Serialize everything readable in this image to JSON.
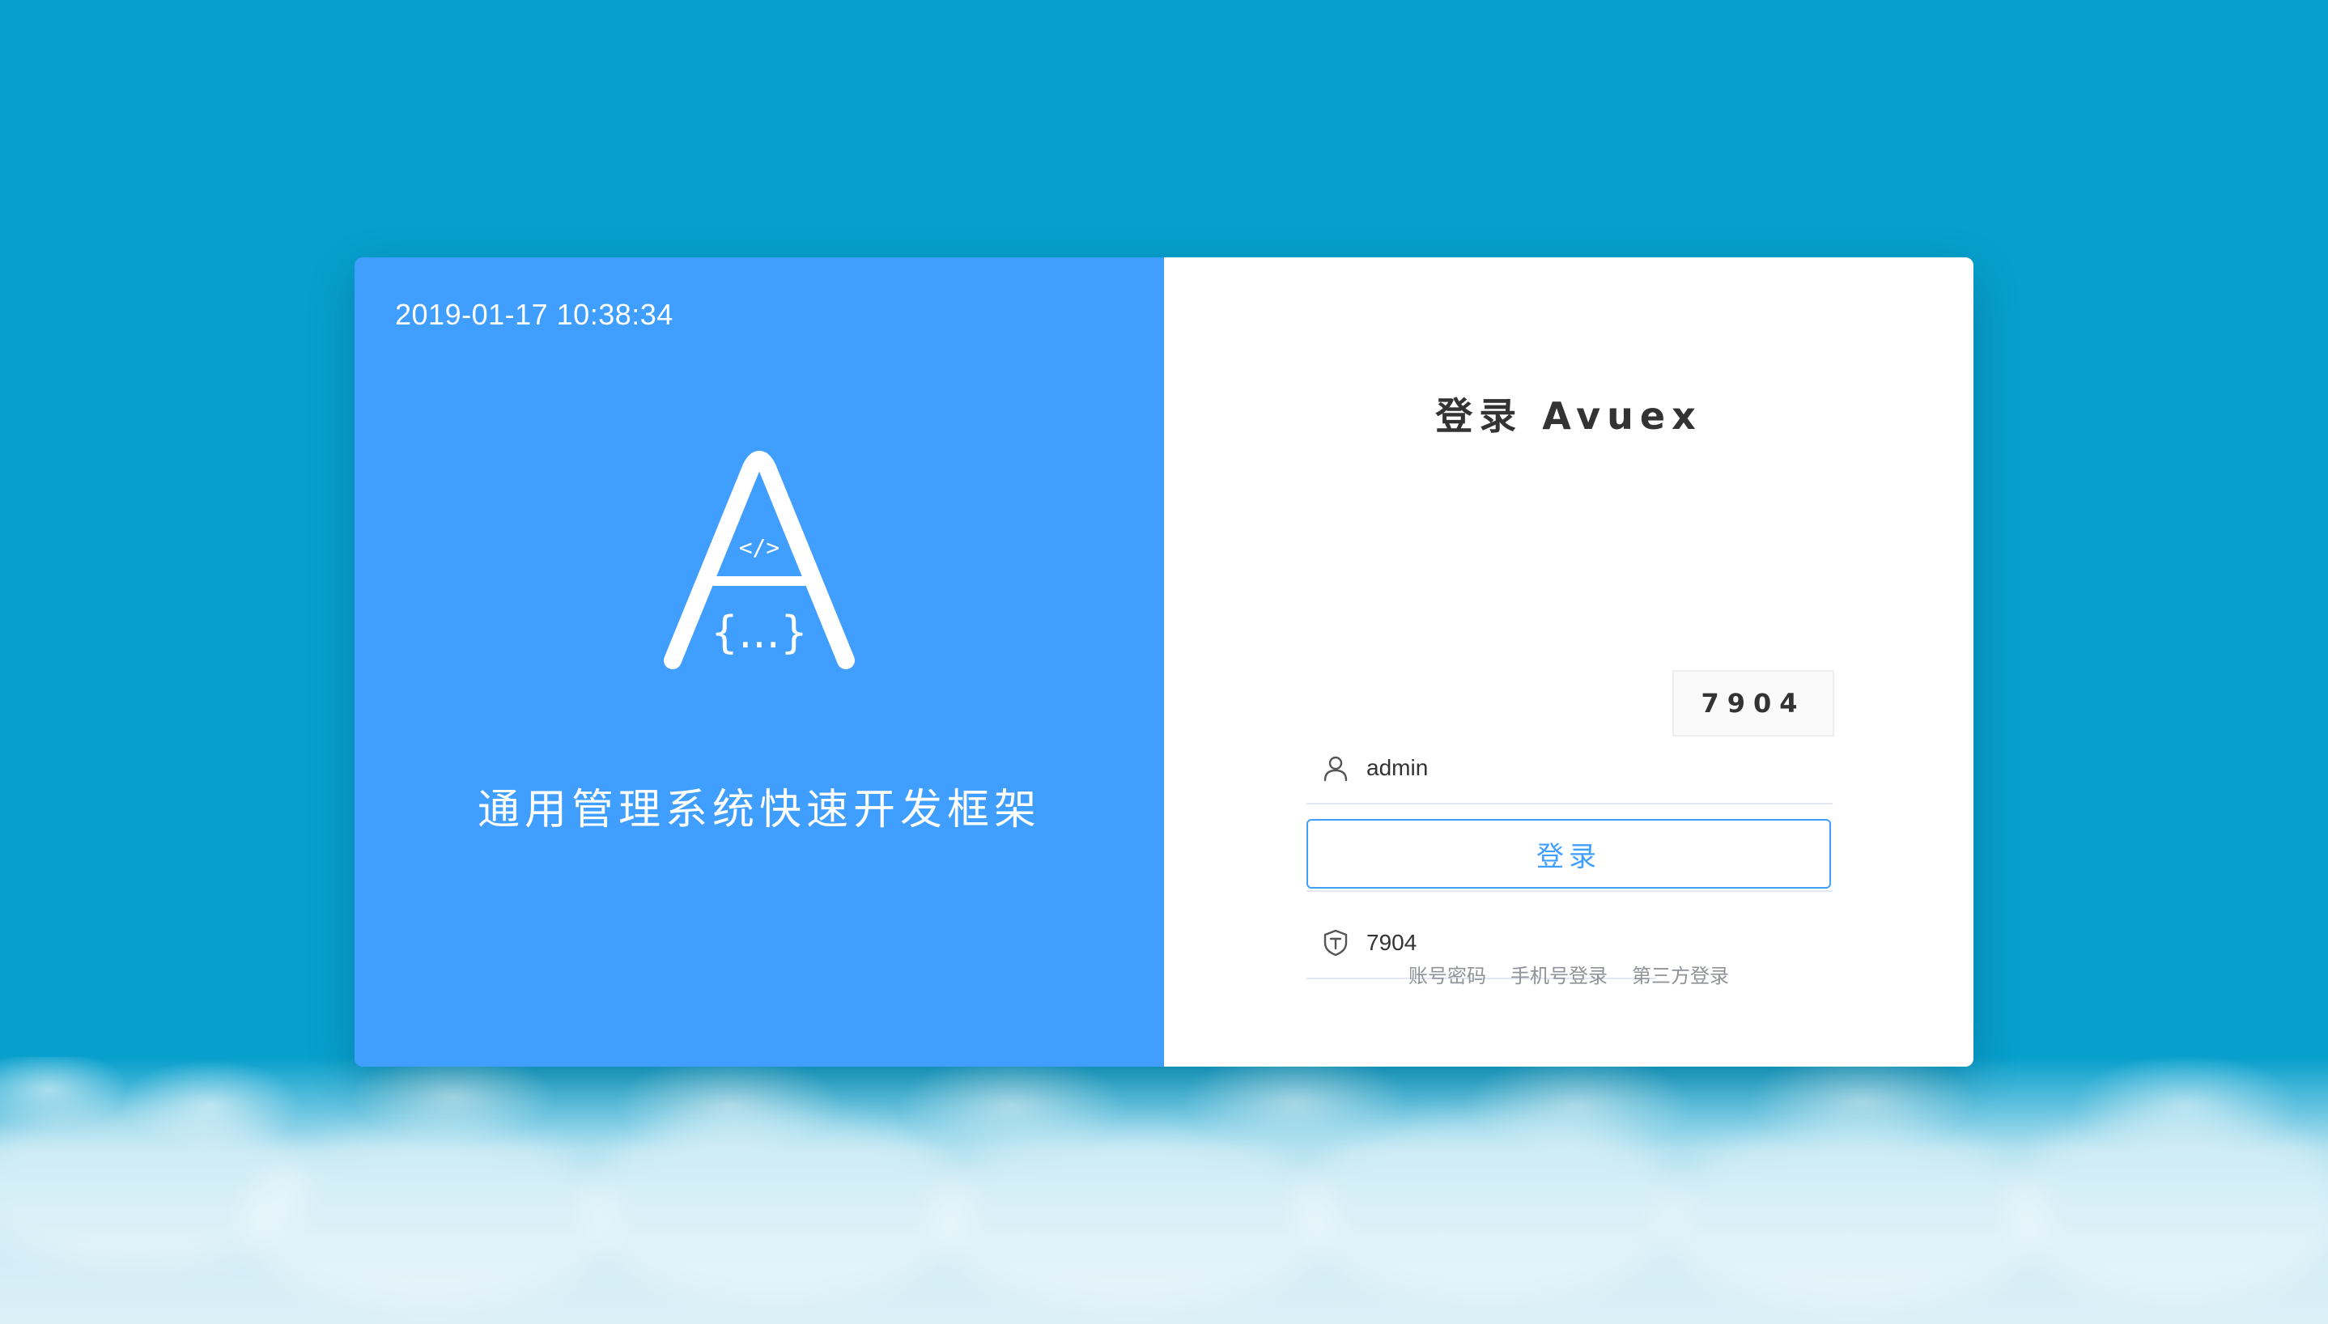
{
  "brand_panel": {
    "datetime": "2019-01-17 10:38:34",
    "logo_letter": "A",
    "logo_code_tag": "</>",
    "logo_braces": "{...}",
    "slogan": "通用管理系统快速开发框架"
  },
  "login_form": {
    "title": "登录 Avuex",
    "username": {
      "icon": "user-icon",
      "value": "admin"
    },
    "password": {
      "icon": "lock-icon",
      "value": "••••••",
      "toggle_icon": "eye-icon"
    },
    "captcha": {
      "icon": "shield-icon",
      "value": "7904",
      "image_text": "7904"
    },
    "submit_label": "登录",
    "alt_methods": [
      "账号密码",
      "手机号登录",
      "第三方登录"
    ]
  },
  "colors": {
    "background": "#079fcc",
    "brand_panel": "#409eff",
    "accent": "#409eff"
  }
}
